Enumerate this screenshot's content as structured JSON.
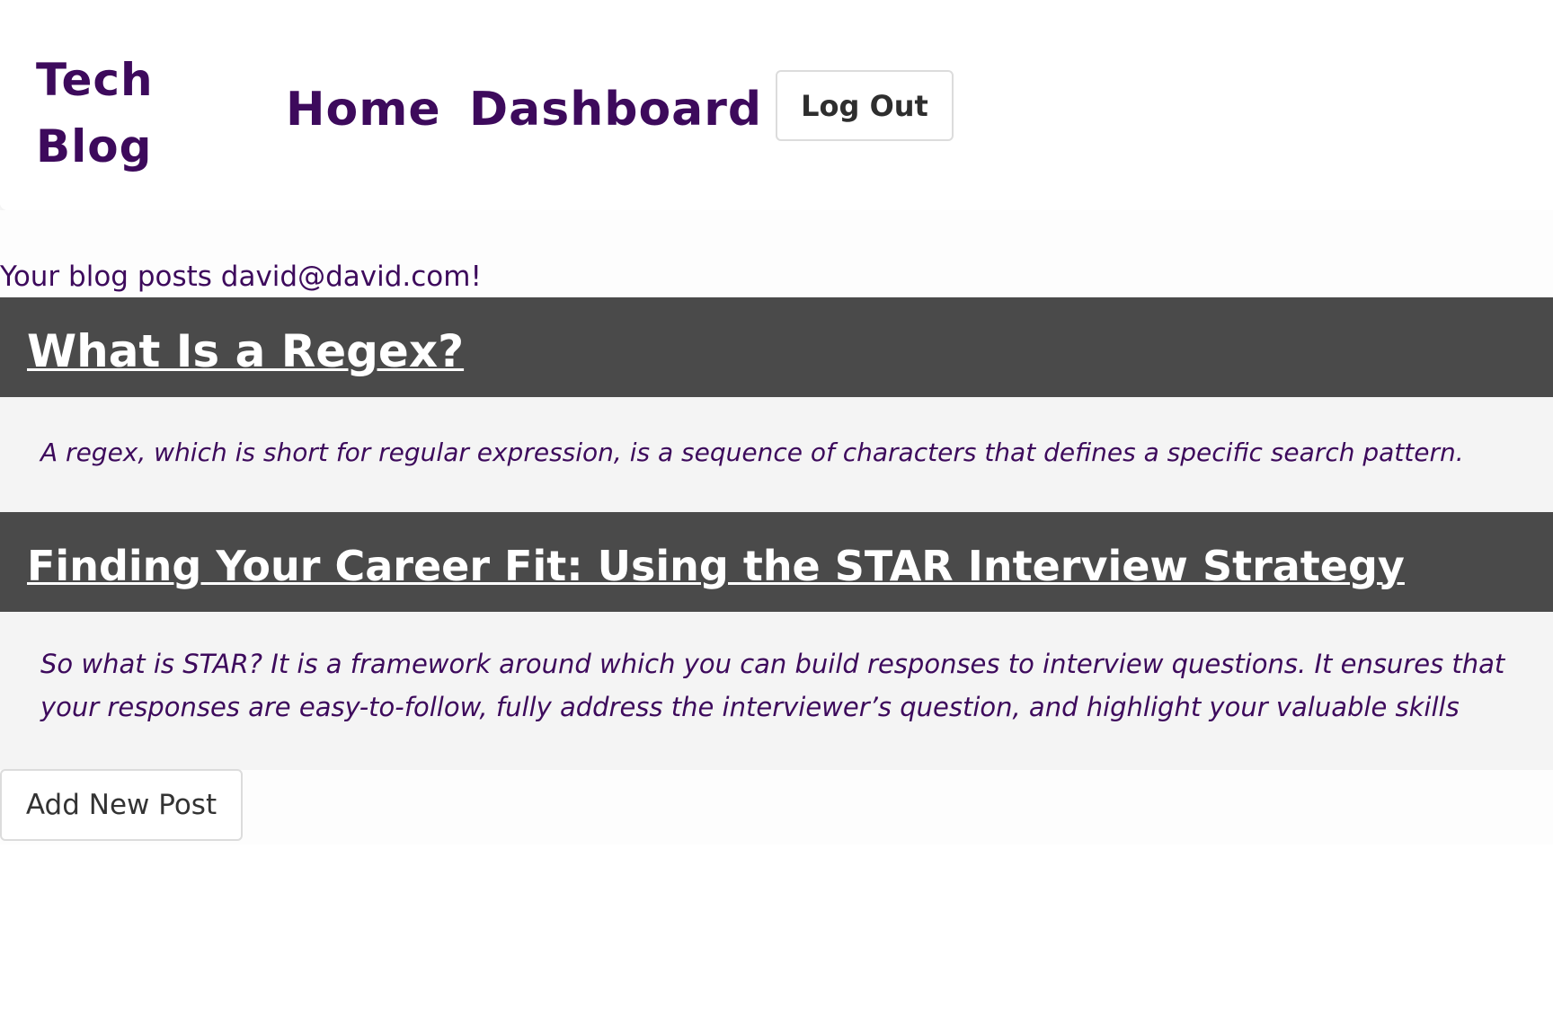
{
  "header": {
    "brand_line1": "Tech",
    "brand_line2": "Blog",
    "nav": {
      "home_label": "Home",
      "dashboard_label": "Dashboard",
      "logout_label": "Log Out"
    }
  },
  "main": {
    "greeting": "Your blog posts david@david.com!",
    "posts": [
      {
        "title": "What Is a Regex?",
        "excerpt": "A regex, which is short for regular expression, is a sequence of characters that defines a specific search pattern."
      },
      {
        "title": "Finding Your Career Fit: Using the STAR Interview Strategy",
        "excerpt": "So what is STAR? It is a framework around which you can build responses to interview questions. It ensures that your responses are easy-to-follow, fully address the interviewer’s question, and highlight your valuable skills"
      }
    ],
    "add_post_label": "Add New Post"
  },
  "colors": {
    "brand_purple": "#3d0a5c",
    "post_header_bg": "#4a4a4a",
    "post_body_bg": "#f4f4f4"
  }
}
